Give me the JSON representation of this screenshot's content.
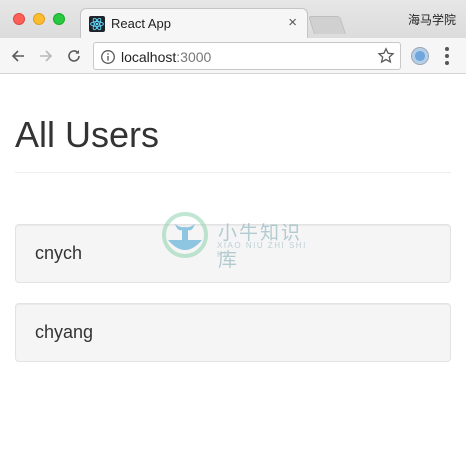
{
  "browser": {
    "tab_title": "React App",
    "tab_close": "×",
    "profile_name": "海马学院",
    "url_host": "localhost",
    "url_port": ":3000"
  },
  "icons": {
    "back": "arrow-left-icon",
    "forward": "arrow-right-icon",
    "reload": "reload-icon",
    "info": "info-icon",
    "bookmark": "star-icon",
    "extension": "extension-icon",
    "menu": "vertical-dots-icon",
    "favicon": "react-logo-icon"
  },
  "colors": {
    "react_cyan": "#61dafb",
    "close": "#fc5f57",
    "minimize": "#fdbc2e",
    "maximize": "#28c840",
    "card_bg": "#f5f5f5",
    "text": "#333333"
  },
  "page": {
    "title": "All Users",
    "users": [
      {
        "name": "cnych"
      },
      {
        "name": "chyang"
      }
    ]
  },
  "watermark": {
    "title": "小牛知识库",
    "subtitle": "XIAO NIU ZHI SHI KU"
  }
}
